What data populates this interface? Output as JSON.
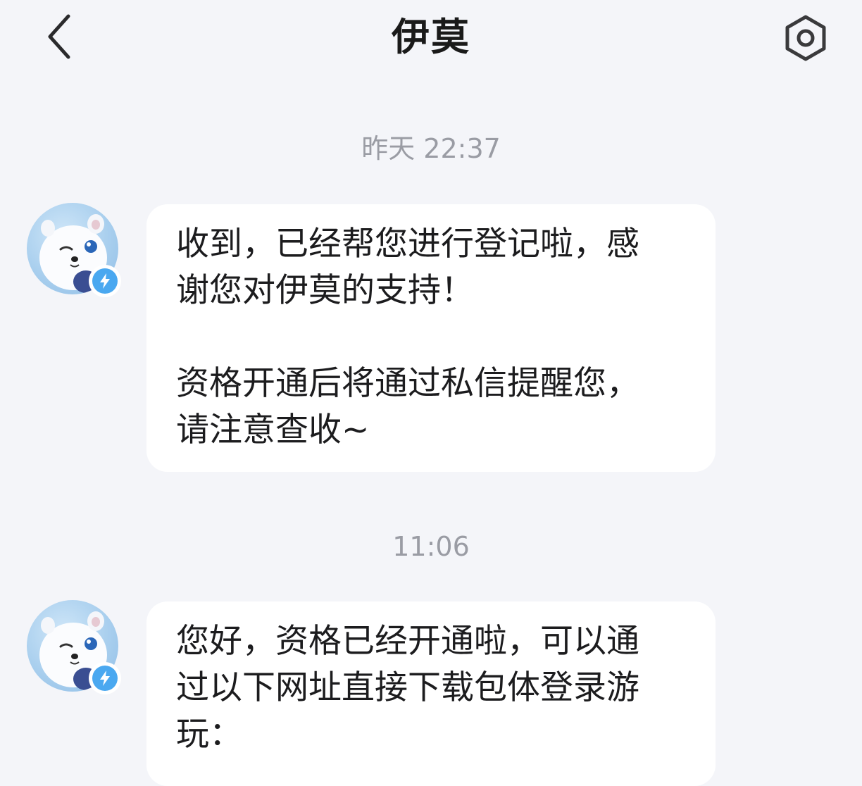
{
  "header": {
    "title": "伊莫",
    "back_icon": "chevron-left-icon",
    "settings_icon": "hexagon-settings-icon"
  },
  "messages": [
    {
      "timestamp": "昨天 22:37",
      "lines": [
        "收到，已经帮您进行登记啦，感",
        "谢您对伊莫的支持！",
        "",
        "资格开通后将通过私信提醒您，",
        "请注意查收~"
      ]
    },
    {
      "timestamp": "11:06",
      "lines": [
        "您好，资格已经开通啦，可以通",
        "过以下网址直接下载包体登录游",
        "玩："
      ]
    }
  ],
  "colors": {
    "background": "#f4f5f9",
    "bubble": "#ffffff",
    "timestamp": "#9a9ca4",
    "badge": "#4aa8f0"
  }
}
